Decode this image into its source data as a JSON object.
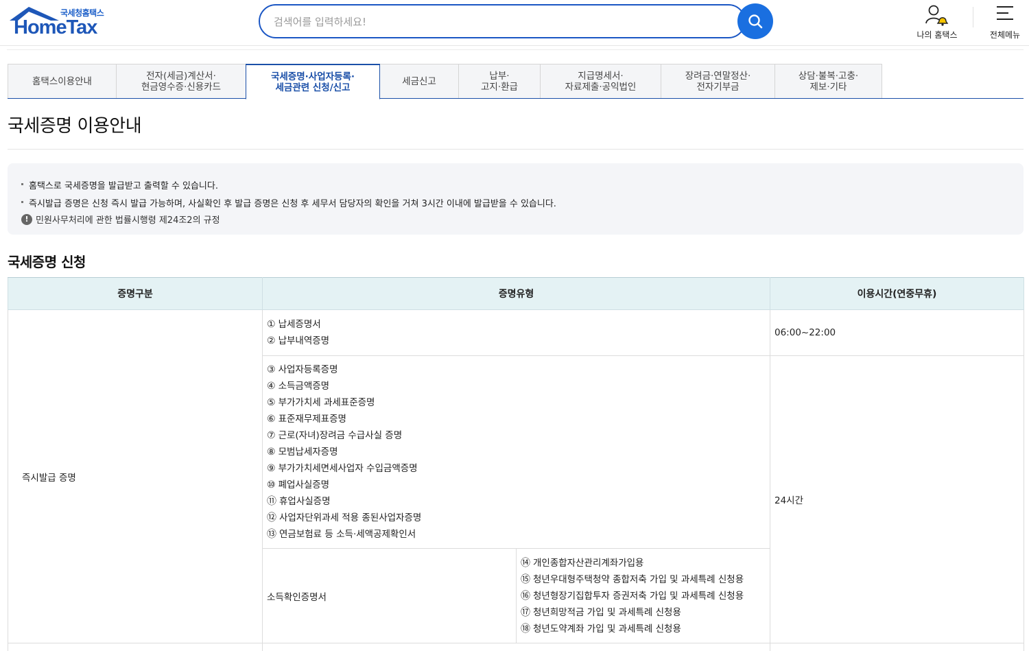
{
  "header": {
    "logo_sub": "국세청홈택스",
    "logo_main": "HomeTax",
    "search_placeholder": "검색어를 입력하세요!",
    "my_hometax": "나의 홈택스",
    "all_menu": "전체메뉴"
  },
  "tabs": [
    {
      "label": "홈택스이용안내"
    },
    {
      "label": "전자(세금)계산서·\n현금영수증·신용카드"
    },
    {
      "label": "국세증명·사업자등록·\n세금관련 신청/신고"
    },
    {
      "label": "세금신고"
    },
    {
      "label": "납부·\n고지·환급"
    },
    {
      "label": "지급명세서·\n자료제출·공익법인"
    },
    {
      "label": "장려금·연말정산·\n전자기부금"
    },
    {
      "label": "상담·불복·고충·\n제보·기타"
    }
  ],
  "page_title": "국세증명 이용안내",
  "info": {
    "line1": "홈택스로 국세증명을 발급받고 출력할 수 있습니다.",
    "line2": "즉시발급 증명은 신청 즉시 발급 가능하며, 사실확인 후 발급 증명은 신청 후 세무서 담당자의 확인을 거쳐 3시간 이내에 발급받을 수 있습니다.",
    "note": "민원사무처리에 관한 법률시행령 제24조2의 규정"
  },
  "section_title": "국세증명 신청",
  "table": {
    "headers": [
      "증명구분",
      "증명유형",
      "이용시간(연중무휴)"
    ],
    "category": "즉시발급 증명",
    "group1": {
      "items": [
        {
          "num": "①",
          "text": "납세증명서"
        },
        {
          "num": "②",
          "text": "납부내역증명"
        }
      ],
      "time": "06:00~22:00"
    },
    "group2": {
      "items": [
        {
          "num": "③",
          "text": "사업자등록증명"
        },
        {
          "num": "④",
          "text": "소득금액증명"
        },
        {
          "num": "⑤",
          "text": "부가가치세 과세표준증명"
        },
        {
          "num": "⑥",
          "text": "표준재무제표증명"
        },
        {
          "num": "⑦",
          "text": "근로(자녀)장려금 수급사실 증명"
        },
        {
          "num": "⑧",
          "text": "모범납세자증명"
        },
        {
          "num": "⑨",
          "text": "부가가치세면세사업자 수입금액증명"
        },
        {
          "num": "⑩",
          "text": "폐업사실증명"
        },
        {
          "num": "⑪",
          "text": "휴업사실증명"
        },
        {
          "num": "⑫",
          "text": "사업자단위과세 적용 종된사업자증명"
        },
        {
          "num": "⑬",
          "text": "연금보험료 등 소득·세액공제확인서"
        }
      ],
      "time": "24시간"
    },
    "group3": {
      "label": "소득확인증명서",
      "items": [
        {
          "num": "⑭",
          "text": "개인종합자산관리계좌가입용"
        },
        {
          "num": "⑮",
          "text": "청년우대형주택청약 종합저축 가입 및 과세특례 신청용"
        },
        {
          "num": "⑯",
          "text": "청년형장기집합투자 증권저축 가입 및 과세특례 신청용"
        },
        {
          "num": "⑰",
          "text": "청년희망적금 가입 및 과세특례 신청용"
        },
        {
          "num": "⑱",
          "text": "청년도약계좌 가입 및 과세특례 신청용"
        }
      ]
    }
  }
}
